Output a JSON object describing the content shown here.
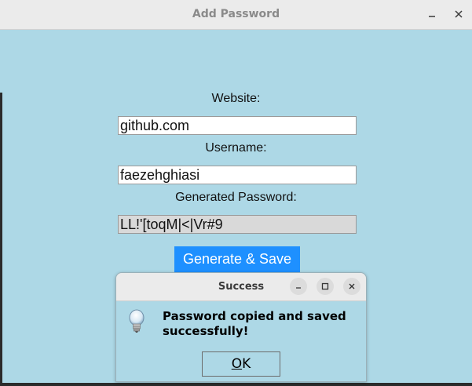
{
  "window": {
    "title": "Add Password"
  },
  "form": {
    "website_label": "Website:",
    "website_value": "github.com",
    "username_label": "Username:",
    "username_value": "faezehghiasi",
    "password_label": "Generated Password:",
    "password_value": "LL!'[toqM|<|Vr#9",
    "generate_button": "Generate & Save"
  },
  "dialog": {
    "title": "Success",
    "message": "Password copied and saved successfully!",
    "ok_mnemonic": "O",
    "ok_rest": "K",
    "icon": "lightbulb-info-icon"
  },
  "colors": {
    "window_bg": "#add8e6",
    "button_bg": "#1e90ff",
    "readonly_bg": "#d9d9d9"
  }
}
